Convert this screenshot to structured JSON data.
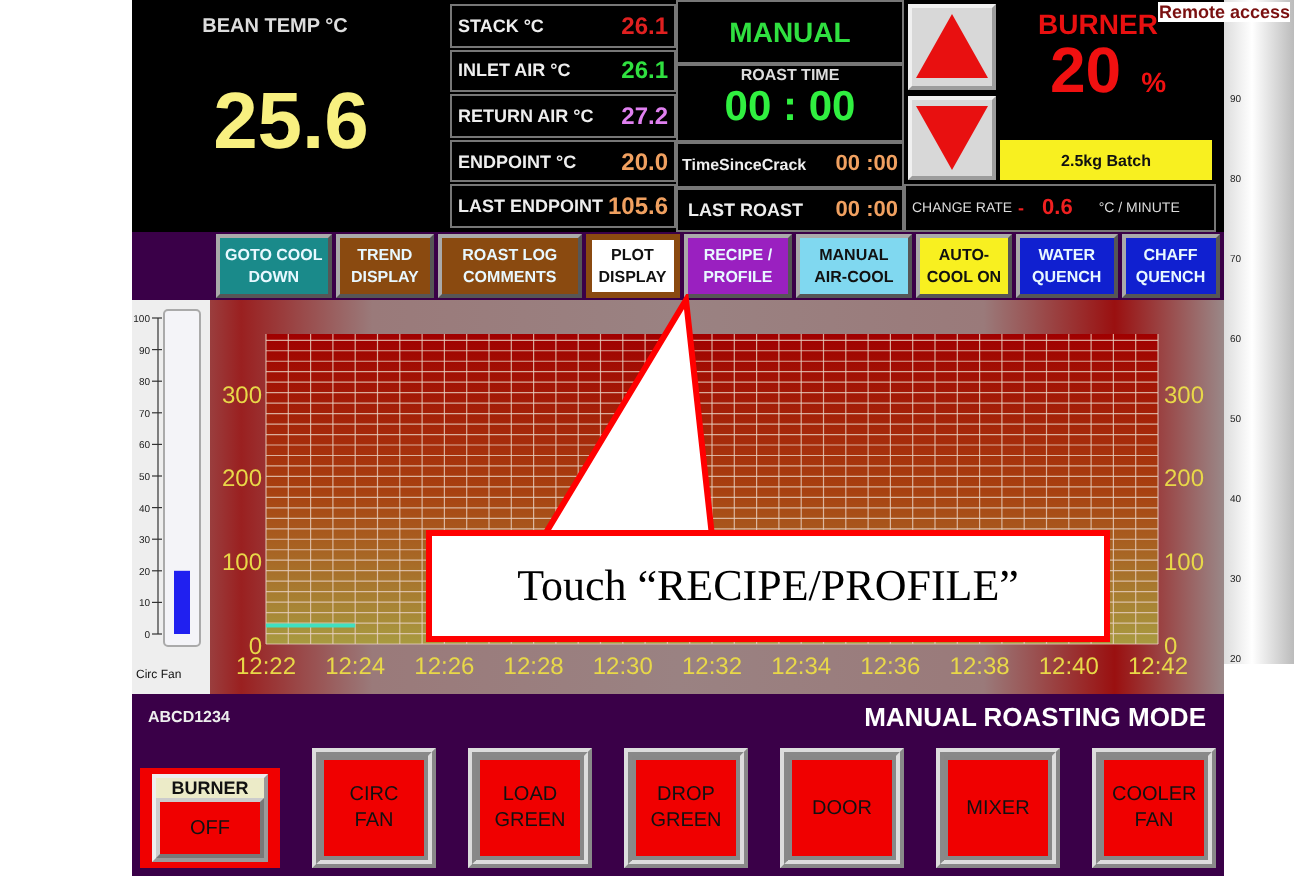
{
  "bean_temp": {
    "label": "BEAN TEMP °C",
    "value": "25.6"
  },
  "readings": [
    {
      "label": "STACK °C",
      "value": "26.1",
      "color": "#e02020"
    },
    {
      "label": "INLET AIR °C",
      "value": "26.1",
      "color": "#30e040"
    },
    {
      "label": "RETURN AIR °C",
      "value": "27.2",
      "color": "#e080f0"
    },
    {
      "label": "ENDPOINT °C",
      "value": "20.0",
      "color": "#f0a060"
    },
    {
      "label": "LAST ENDPOINT",
      "value": "105.6",
      "color": "#f0a060"
    }
  ],
  "mode": "MANUAL",
  "roast_time": {
    "label": "ROAST TIME",
    "value": "00 : 00"
  },
  "time_since_crack": {
    "label": "TimeSinceCrack",
    "value": "00 :00"
  },
  "last_roast": {
    "label": "LAST ROAST",
    "value": "00 :00"
  },
  "burner": {
    "label": "BURNER",
    "value": "20",
    "unit": "%"
  },
  "batch": "2.5kg Batch",
  "change_rate": {
    "label": "CHANGE RATE",
    "sign": "-",
    "value": "0.6",
    "unit": "°C / MINUTE"
  },
  "remote_access": "Remote access",
  "toolbar": [
    {
      "label": "GOTO COOL DOWN",
      "color": "#1a8a8a",
      "selected": false
    },
    {
      "label": "TREND DISPLAY",
      "color": "#8a4a10",
      "selected": false
    },
    {
      "label": "ROAST LOG COMMENTS",
      "color": "#8a4a10",
      "selected": false
    },
    {
      "label": "PLOT DISPLAY",
      "color": "#8a4a10",
      "selected": true
    },
    {
      "label": "RECIPE / PROFILE",
      "color": "#9a20c0",
      "selected": false
    },
    {
      "label": "MANUAL AIR-COOL",
      "color": "#80d8f0",
      "selected": false
    },
    {
      "label": "AUTO-COOL ON",
      "color": "#f8f020",
      "selected": false
    },
    {
      "label": "WATER QUENCH",
      "color": "#1020d0",
      "selected": false
    },
    {
      "label": "CHAFF QUENCH",
      "color": "#1020d0",
      "selected": false
    }
  ],
  "fan_gauge": {
    "label": "Circ Fan",
    "level": 0.2,
    "ticks": [
      "100",
      "90",
      "80",
      "70",
      "60",
      "50",
      "40",
      "30",
      "20",
      "10",
      "0"
    ]
  },
  "right_gauge": {
    "ticks": [
      "90",
      "80",
      "70",
      "60",
      "50",
      "40",
      "30",
      "20"
    ]
  },
  "chart": {
    "chart_data": {
      "type": "line",
      "categories": [
        "12:22",
        "12:24",
        "12:26",
        "12:28",
        "12:30",
        "12:32",
        "12:34",
        "12:36",
        "12:38",
        "12:40",
        "12:42"
      ],
      "series": [
        {
          "color": "#40e0c0",
          "values": [
            22,
            22,
            null,
            null,
            null,
            null,
            null,
            null,
            null,
            null,
            null
          ]
        }
      ],
      "ylim": [
        0,
        370
      ],
      "yticks": [
        0,
        100,
        200,
        300
      ],
      "grid": true
    },
    "right_axis_ticks": [
      "300",
      "200",
      "100",
      "0"
    ]
  },
  "callout": "Touch “RECIPE/PROFILE”",
  "bottom": {
    "unit_id": "ABCD1234",
    "title": "MANUAL ROASTING MODE",
    "buttons": [
      {
        "kind": "toggle",
        "header": "BURNER",
        "label": "OFF"
      },
      {
        "kind": "push",
        "label": "CIRC FAN"
      },
      {
        "kind": "push",
        "label": "LOAD GREEN"
      },
      {
        "kind": "push",
        "label": "DROP GREEN"
      },
      {
        "kind": "push",
        "label": "DOOR"
      },
      {
        "kind": "push",
        "label": "MIXER"
      },
      {
        "kind": "push",
        "label": "COOLER FAN"
      }
    ]
  }
}
